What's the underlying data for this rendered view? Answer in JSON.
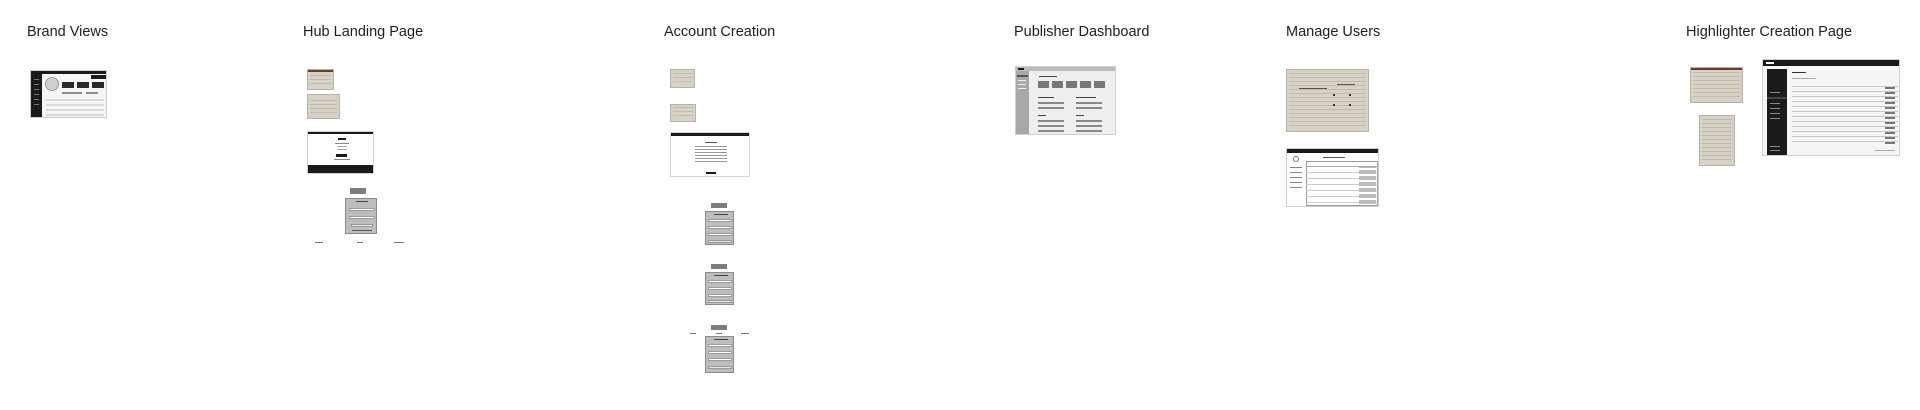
{
  "sections": [
    {
      "id": "brand-views",
      "title": "Brand Views"
    },
    {
      "id": "hub-landing-page",
      "title": "Hub Landing Page"
    },
    {
      "id": "account-creation",
      "title": "Account Creation"
    },
    {
      "id": "publisher-dashboard",
      "title": "Publisher Dashboard"
    },
    {
      "id": "manage-users",
      "title": "Manage Users"
    },
    {
      "id": "highlighter-creation-page",
      "title": "Highlighter Creation Page"
    }
  ],
  "colors": {
    "background": "#ffffff",
    "title_text": "#1e1e1e",
    "dark_chrome": "#151515",
    "sketch_paper": "#d6d2c6",
    "wire_gray": "#bdbdbd"
  }
}
